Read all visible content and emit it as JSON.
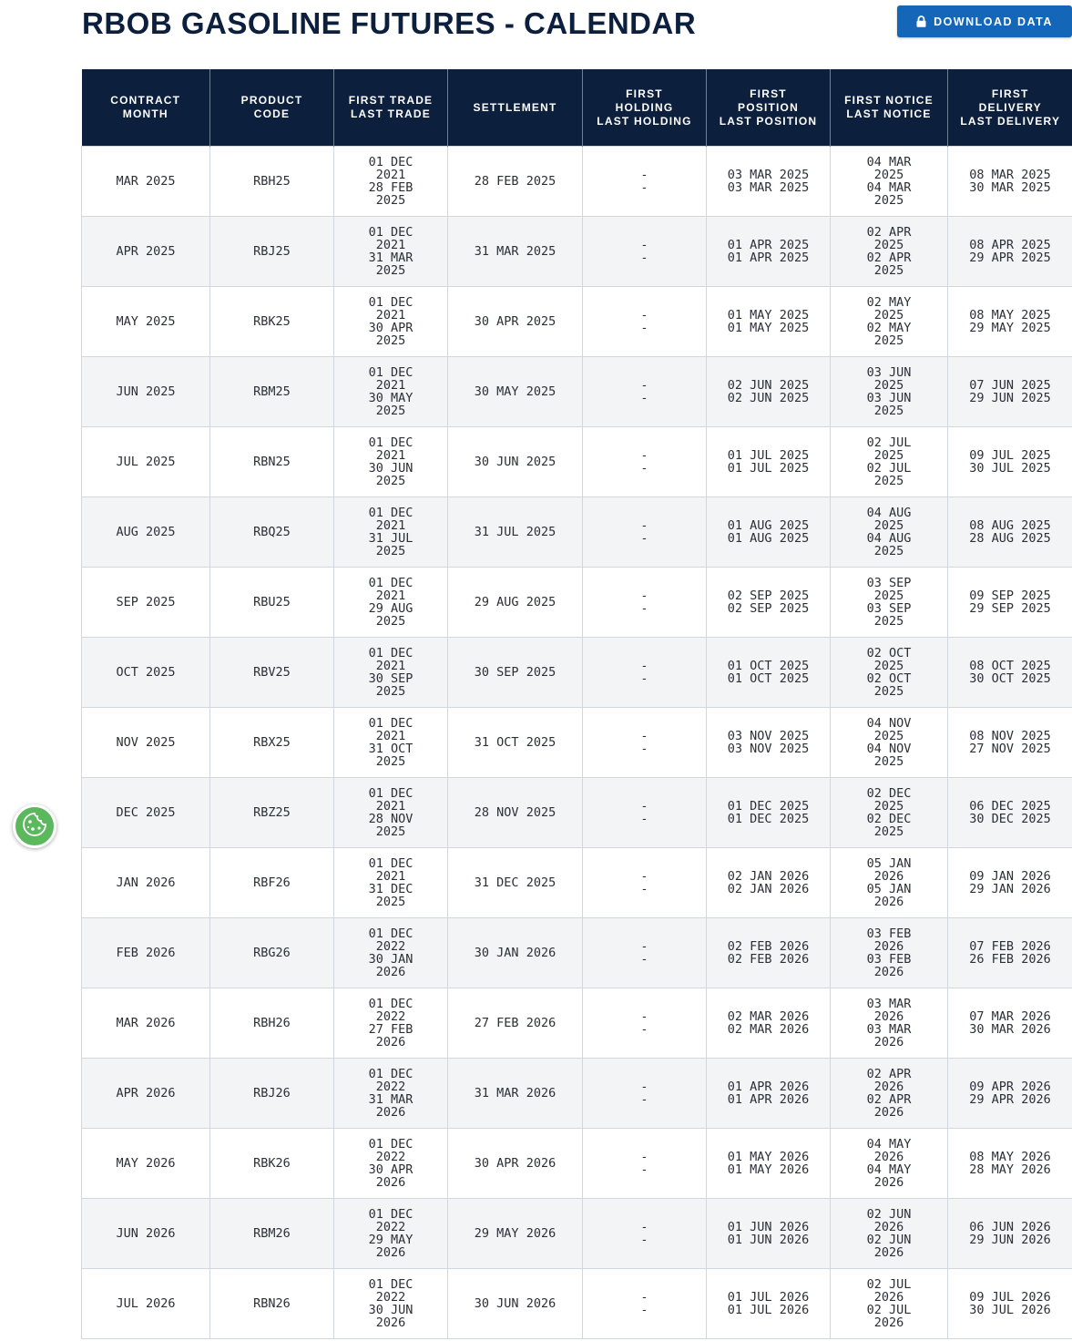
{
  "page": {
    "title": "RBOB GASOLINE FUTURES - CALENDAR",
    "download_label": "DOWNLOAD DATA"
  },
  "colors": {
    "header_bg": "#0c1f3d",
    "button_bg": "#1466b8",
    "row_alt_bg": "#f2f4f6",
    "cookie_bg": "#5cb85c"
  },
  "icons": {
    "download_button_icon": "lock-icon",
    "cookie_button_icon": "cookie-icon"
  },
  "table": {
    "headers": [
      [
        "CONTRACT",
        "MONTH"
      ],
      [
        "PRODUCT",
        "CODE"
      ],
      [
        "FIRST TRADE",
        "LAST TRADE"
      ],
      [
        "SETTLEMENT"
      ],
      [
        "FIRST",
        "HOLDING",
        "LAST HOLDING"
      ],
      [
        "FIRST",
        "POSITION",
        "LAST POSITION"
      ],
      [
        "FIRST NOTICE",
        "LAST NOTICE"
      ],
      [
        "FIRST",
        "DELIVERY",
        "LAST DELIVERY"
      ]
    ],
    "rows": [
      {
        "month": "MAR 2025",
        "code": "RBH25",
        "trade": [
          "01 DEC",
          "2021",
          "28 FEB",
          "2025"
        ],
        "settlement": "28 FEB 2025",
        "holding": [
          "-",
          "-"
        ],
        "position": [
          "03 MAR 2025",
          "03 MAR 2025"
        ],
        "notice": [
          "04 MAR",
          "2025",
          "04 MAR",
          "2025"
        ],
        "delivery": [
          "08 MAR 2025",
          "30 MAR 2025"
        ]
      },
      {
        "month": "APR 2025",
        "code": "RBJ25",
        "trade": [
          "01 DEC",
          "2021",
          "31 MAR",
          "2025"
        ],
        "settlement": "31 MAR 2025",
        "holding": [
          "-",
          "-"
        ],
        "position": [
          "01 APR 2025",
          "01 APR 2025"
        ],
        "notice": [
          "02 APR",
          "2025",
          "02 APR",
          "2025"
        ],
        "delivery": [
          "08 APR 2025",
          "29 APR 2025"
        ]
      },
      {
        "month": "MAY 2025",
        "code": "RBK25",
        "trade": [
          "01 DEC",
          "2021",
          "30 APR",
          "2025"
        ],
        "settlement": "30 APR 2025",
        "holding": [
          "-",
          "-"
        ],
        "position": [
          "01 MAY 2025",
          "01 MAY 2025"
        ],
        "notice": [
          "02 MAY",
          "2025",
          "02 MAY",
          "2025"
        ],
        "delivery": [
          "08 MAY 2025",
          "29 MAY 2025"
        ]
      },
      {
        "month": "JUN 2025",
        "code": "RBM25",
        "trade": [
          "01 DEC",
          "2021",
          "30 MAY",
          "2025"
        ],
        "settlement": "30 MAY 2025",
        "holding": [
          "-",
          "-"
        ],
        "position": [
          "02 JUN 2025",
          "02 JUN 2025"
        ],
        "notice": [
          "03 JUN",
          "2025",
          "03 JUN",
          "2025"
        ],
        "delivery": [
          "07 JUN 2025",
          "29 JUN 2025"
        ]
      },
      {
        "month": "JUL 2025",
        "code": "RBN25",
        "trade": [
          "01 DEC",
          "2021",
          "30 JUN",
          "2025"
        ],
        "settlement": "30 JUN 2025",
        "holding": [
          "-",
          "-"
        ],
        "position": [
          "01 JUL 2025",
          "01 JUL 2025"
        ],
        "notice": [
          "02 JUL",
          "2025",
          "02 JUL",
          "2025"
        ],
        "delivery": [
          "09 JUL 2025",
          "30 JUL 2025"
        ]
      },
      {
        "month": "AUG 2025",
        "code": "RBQ25",
        "trade": [
          "01 DEC",
          "2021",
          "31 JUL",
          "2025"
        ],
        "settlement": "31 JUL 2025",
        "holding": [
          "-",
          "-"
        ],
        "position": [
          "01 AUG 2025",
          "01 AUG 2025"
        ],
        "notice": [
          "04 AUG",
          "2025",
          "04 AUG",
          "2025"
        ],
        "delivery": [
          "08 AUG 2025",
          "28 AUG 2025"
        ]
      },
      {
        "month": "SEP 2025",
        "code": "RBU25",
        "trade": [
          "01 DEC",
          "2021",
          "29 AUG",
          "2025"
        ],
        "settlement": "29 AUG 2025",
        "holding": [
          "-",
          "-"
        ],
        "position": [
          "02 SEP 2025",
          "02 SEP 2025"
        ],
        "notice": [
          "03 SEP",
          "2025",
          "03 SEP",
          "2025"
        ],
        "delivery": [
          "09 SEP 2025",
          "29 SEP 2025"
        ]
      },
      {
        "month": "OCT 2025",
        "code": "RBV25",
        "trade": [
          "01 DEC",
          "2021",
          "30 SEP",
          "2025"
        ],
        "settlement": "30 SEP 2025",
        "holding": [
          "-",
          "-"
        ],
        "position": [
          "01 OCT 2025",
          "01 OCT 2025"
        ],
        "notice": [
          "02 OCT",
          "2025",
          "02 OCT",
          "2025"
        ],
        "delivery": [
          "08 OCT 2025",
          "30 OCT 2025"
        ]
      },
      {
        "month": "NOV 2025",
        "code": "RBX25",
        "trade": [
          "01 DEC",
          "2021",
          "31 OCT",
          "2025"
        ],
        "settlement": "31 OCT 2025",
        "holding": [
          "-",
          "-"
        ],
        "position": [
          "03 NOV 2025",
          "03 NOV 2025"
        ],
        "notice": [
          "04 NOV",
          "2025",
          "04 NOV",
          "2025"
        ],
        "delivery": [
          "08 NOV 2025",
          "27 NOV 2025"
        ]
      },
      {
        "month": "DEC 2025",
        "code": "RBZ25",
        "trade": [
          "01 DEC",
          "2021",
          "28 NOV",
          "2025"
        ],
        "settlement": "28 NOV 2025",
        "holding": [
          "-",
          "-"
        ],
        "position": [
          "01 DEC 2025",
          "01 DEC 2025"
        ],
        "notice": [
          "02 DEC",
          "2025",
          "02 DEC",
          "2025"
        ],
        "delivery": [
          "06 DEC 2025",
          "30 DEC 2025"
        ]
      },
      {
        "month": "JAN 2026",
        "code": "RBF26",
        "trade": [
          "01 DEC",
          "2021",
          "31 DEC",
          "2025"
        ],
        "settlement": "31 DEC 2025",
        "holding": [
          "-",
          "-"
        ],
        "position": [
          "02 JAN 2026",
          "02 JAN 2026"
        ],
        "notice": [
          "05 JAN",
          "2026",
          "05 JAN",
          "2026"
        ],
        "delivery": [
          "09 JAN 2026",
          "29 JAN 2026"
        ]
      },
      {
        "month": "FEB 2026",
        "code": "RBG26",
        "trade": [
          "01 DEC",
          "2022",
          "30 JAN",
          "2026"
        ],
        "settlement": "30 JAN 2026",
        "holding": [
          "-",
          "-"
        ],
        "position": [
          "02 FEB 2026",
          "02 FEB 2026"
        ],
        "notice": [
          "03 FEB",
          "2026",
          "03 FEB",
          "2026"
        ],
        "delivery": [
          "07 FEB 2026",
          "26 FEB 2026"
        ]
      },
      {
        "month": "MAR 2026",
        "code": "RBH26",
        "trade": [
          "01 DEC",
          "2022",
          "27 FEB",
          "2026"
        ],
        "settlement": "27 FEB 2026",
        "holding": [
          "-",
          "-"
        ],
        "position": [
          "02 MAR 2026",
          "02 MAR 2026"
        ],
        "notice": [
          "03 MAR",
          "2026",
          "03 MAR",
          "2026"
        ],
        "delivery": [
          "07 MAR 2026",
          "30 MAR 2026"
        ]
      },
      {
        "month": "APR 2026",
        "code": "RBJ26",
        "trade": [
          "01 DEC",
          "2022",
          "31 MAR",
          "2026"
        ],
        "settlement": "31 MAR 2026",
        "holding": [
          "-",
          "-"
        ],
        "position": [
          "01 APR 2026",
          "01 APR 2026"
        ],
        "notice": [
          "02 APR",
          "2026",
          "02 APR",
          "2026"
        ],
        "delivery": [
          "09 APR 2026",
          "29 APR 2026"
        ]
      },
      {
        "month": "MAY 2026",
        "code": "RBK26",
        "trade": [
          "01 DEC",
          "2022",
          "30 APR",
          "2026"
        ],
        "settlement": "30 APR 2026",
        "holding": [
          "-",
          "-"
        ],
        "position": [
          "01 MAY 2026",
          "01 MAY 2026"
        ],
        "notice": [
          "04 MAY",
          "2026",
          "04 MAY",
          "2026"
        ],
        "delivery": [
          "08 MAY 2026",
          "28 MAY 2026"
        ]
      },
      {
        "month": "JUN 2026",
        "code": "RBM26",
        "trade": [
          "01 DEC",
          "2022",
          "29 MAY",
          "2026"
        ],
        "settlement": "29 MAY 2026",
        "holding": [
          "-",
          "-"
        ],
        "position": [
          "01 JUN 2026",
          "01 JUN 2026"
        ],
        "notice": [
          "02 JUN",
          "2026",
          "02 JUN",
          "2026"
        ],
        "delivery": [
          "06 JUN 2026",
          "29 JUN 2026"
        ]
      },
      {
        "month": "JUL 2026",
        "code": "RBN26",
        "trade": [
          "01 DEC",
          "2022",
          "30 JUN",
          "2026"
        ],
        "settlement": "30 JUN 2026",
        "holding": [
          "-",
          "-"
        ],
        "position": [
          "01 JUL 2026",
          "01 JUL 2026"
        ],
        "notice": [
          "02 JUL",
          "2026",
          "02 JUL",
          "2026"
        ],
        "delivery": [
          "09 JUL 2026",
          "30 JUL 2026"
        ]
      }
    ]
  }
}
